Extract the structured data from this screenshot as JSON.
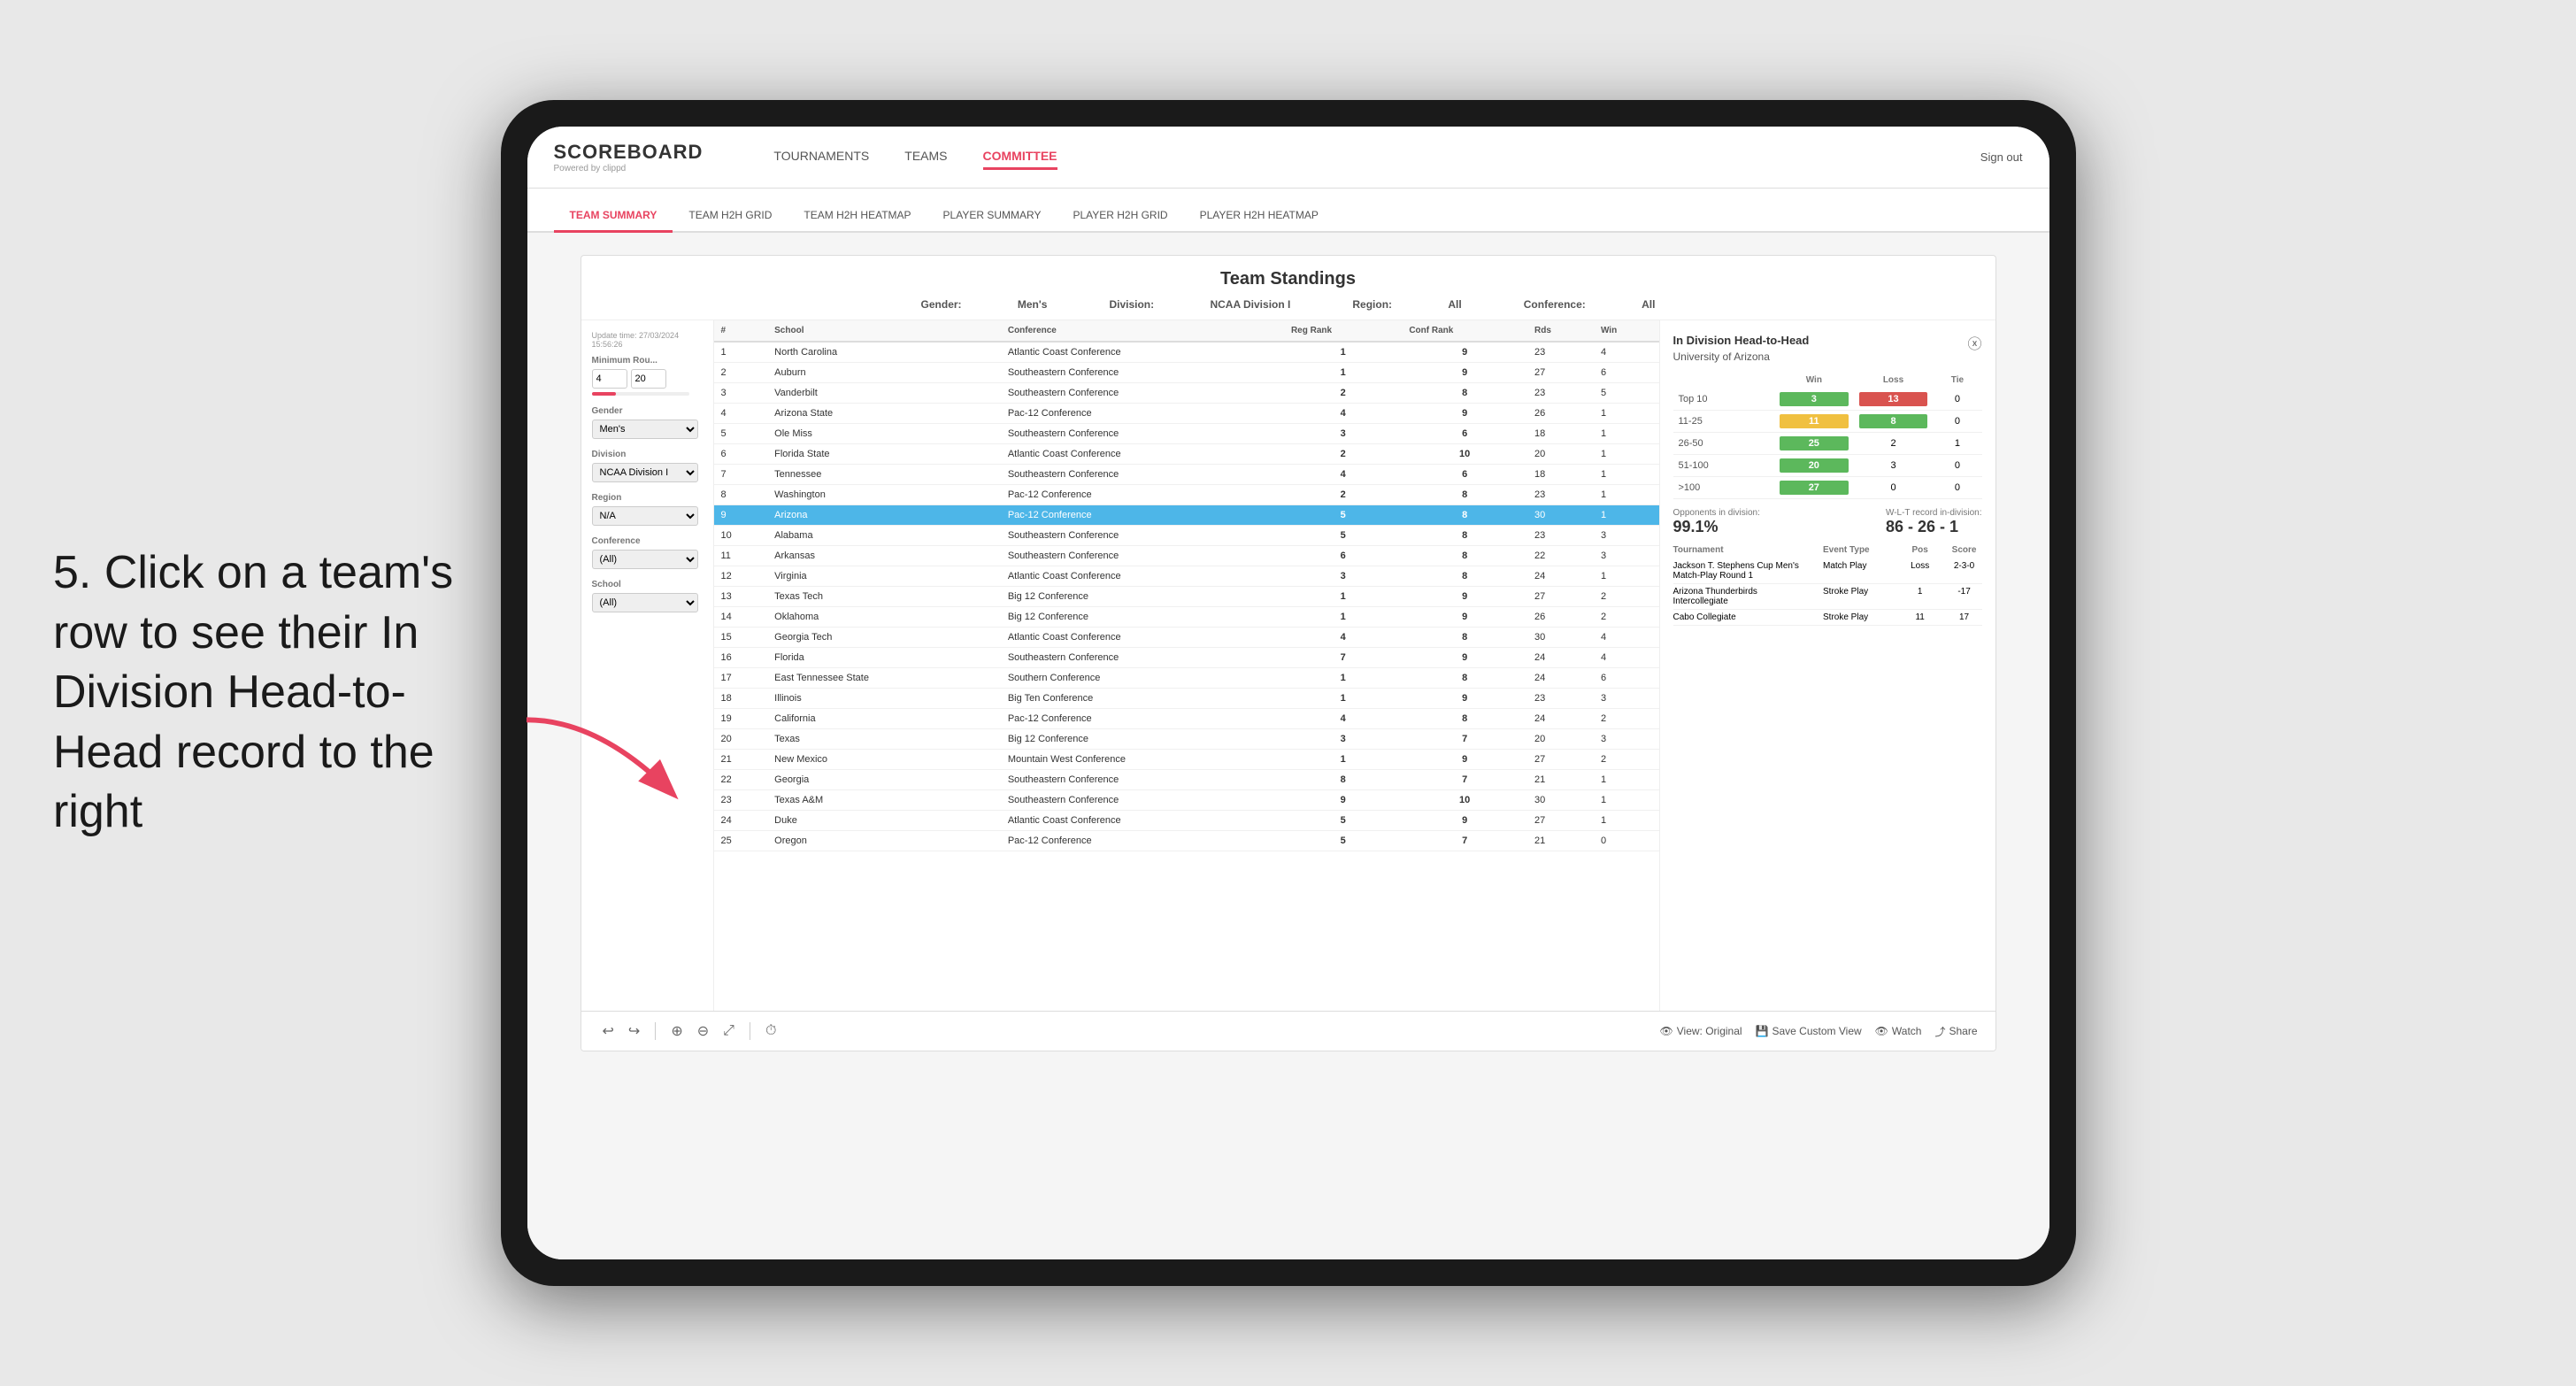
{
  "instruction": {
    "step": "5. Click on a team's row to see their In Division Head-to-Head record to the right"
  },
  "header": {
    "logo": "SCOREBOARD",
    "logo_sub": "Powered by clippd",
    "nav": [
      {
        "label": "TOURNAMENTS",
        "active": false
      },
      {
        "label": "TEAMS",
        "active": false
      },
      {
        "label": "COMMITTEE",
        "active": true
      }
    ],
    "sign_out": "Sign out"
  },
  "sub_nav": [
    {
      "label": "TEAM SUMMARY",
      "active": true
    },
    {
      "label": "TEAM H2H GRID",
      "active": false
    },
    {
      "label": "TEAM H2H HEATMAP",
      "active": false
    },
    {
      "label": "PLAYER SUMMARY",
      "active": false
    },
    {
      "label": "PLAYER H2H GRID",
      "active": false
    },
    {
      "label": "PLAYER H2H HEATMAP",
      "active": false
    }
  ],
  "panel": {
    "update_time": "Update time: 27/03/2024 15:56:26",
    "title": "Team Standings",
    "gender_label": "Gender:",
    "gender_value": "Men's",
    "division_label": "Division:",
    "division_value": "NCAA Division I",
    "region_label": "Region:",
    "region_value": "All",
    "conference_label": "Conference:",
    "conference_value": "All"
  },
  "filters": {
    "min_rounds_label": "Minimum Rou...",
    "min_rounds_value": "4",
    "min_rounds_max": "20",
    "gender_label": "Gender",
    "gender_value": "Men's",
    "division_label": "Division",
    "division_value": "NCAA Division I",
    "region_label": "Region",
    "region_value": "N/A",
    "conference_label": "Conference",
    "conference_value": "(All)",
    "school_label": "School",
    "school_value": "(All)"
  },
  "table": {
    "headers": [
      "#",
      "School",
      "Conference",
      "Reg Rank",
      "Conf Rank",
      "Rds",
      "Win"
    ],
    "rows": [
      {
        "rank": 1,
        "school": "North Carolina",
        "conference": "Atlantic Coast Conference",
        "reg_rank": 1,
        "conf_rank": 9,
        "rds": 23,
        "win": 4,
        "highlighted": false
      },
      {
        "rank": 2,
        "school": "Auburn",
        "conference": "Southeastern Conference",
        "reg_rank": 1,
        "conf_rank": 9,
        "rds": 27,
        "win": 6,
        "highlighted": false
      },
      {
        "rank": 3,
        "school": "Vanderbilt",
        "conference": "Southeastern Conference",
        "reg_rank": 2,
        "conf_rank": 8,
        "rds": 23,
        "win": 5,
        "highlighted": false
      },
      {
        "rank": 4,
        "school": "Arizona State",
        "conference": "Pac-12 Conference",
        "reg_rank": 4,
        "conf_rank": 9,
        "rds": 26,
        "win": 1,
        "highlighted": false
      },
      {
        "rank": 5,
        "school": "Ole Miss",
        "conference": "Southeastern Conference",
        "reg_rank": 3,
        "conf_rank": 6,
        "rds": 18,
        "win": 1,
        "highlighted": false
      },
      {
        "rank": 6,
        "school": "Florida State",
        "conference": "Atlantic Coast Conference",
        "reg_rank": 2,
        "conf_rank": 10,
        "rds": 20,
        "win": 1,
        "highlighted": false
      },
      {
        "rank": 7,
        "school": "Tennessee",
        "conference": "Southeastern Conference",
        "reg_rank": 4,
        "conf_rank": 6,
        "rds": 18,
        "win": 1,
        "highlighted": false
      },
      {
        "rank": 8,
        "school": "Washington",
        "conference": "Pac-12 Conference",
        "reg_rank": 2,
        "conf_rank": 8,
        "rds": 23,
        "win": 1,
        "highlighted": false
      },
      {
        "rank": 9,
        "school": "Arizona",
        "conference": "Pac-12 Conference",
        "reg_rank": 5,
        "conf_rank": 8,
        "rds": 30,
        "win": 1,
        "highlighted": true
      },
      {
        "rank": 10,
        "school": "Alabama",
        "conference": "Southeastern Conference",
        "reg_rank": 5,
        "conf_rank": 8,
        "rds": 23,
        "win": 3,
        "highlighted": false
      },
      {
        "rank": 11,
        "school": "Arkansas",
        "conference": "Southeastern Conference",
        "reg_rank": 6,
        "conf_rank": 8,
        "rds": 22,
        "win": 3,
        "highlighted": false
      },
      {
        "rank": 12,
        "school": "Virginia",
        "conference": "Atlantic Coast Conference",
        "reg_rank": 3,
        "conf_rank": 8,
        "rds": 24,
        "win": 1,
        "highlighted": false
      },
      {
        "rank": 13,
        "school": "Texas Tech",
        "conference": "Big 12 Conference",
        "reg_rank": 1,
        "conf_rank": 9,
        "rds": 27,
        "win": 2,
        "highlighted": false
      },
      {
        "rank": 14,
        "school": "Oklahoma",
        "conference": "Big 12 Conference",
        "reg_rank": 1,
        "conf_rank": 9,
        "rds": 26,
        "win": 2,
        "highlighted": false
      },
      {
        "rank": 15,
        "school": "Georgia Tech",
        "conference": "Atlantic Coast Conference",
        "reg_rank": 4,
        "conf_rank": 8,
        "rds": 30,
        "win": 4,
        "highlighted": false
      },
      {
        "rank": 16,
        "school": "Florida",
        "conference": "Southeastern Conference",
        "reg_rank": 7,
        "conf_rank": 9,
        "rds": 24,
        "win": 4,
        "highlighted": false
      },
      {
        "rank": 17,
        "school": "East Tennessee State",
        "conference": "Southern Conference",
        "reg_rank": 1,
        "conf_rank": 8,
        "rds": 24,
        "win": 6,
        "highlighted": false
      },
      {
        "rank": 18,
        "school": "Illinois",
        "conference": "Big Ten Conference",
        "reg_rank": 1,
        "conf_rank": 9,
        "rds": 23,
        "win": 3,
        "highlighted": false
      },
      {
        "rank": 19,
        "school": "California",
        "conference": "Pac-12 Conference",
        "reg_rank": 4,
        "conf_rank": 8,
        "rds": 24,
        "win": 2,
        "highlighted": false
      },
      {
        "rank": 20,
        "school": "Texas",
        "conference": "Big 12 Conference",
        "reg_rank": 3,
        "conf_rank": 7,
        "rds": 20,
        "win": 3,
        "highlighted": false
      },
      {
        "rank": 21,
        "school": "New Mexico",
        "conference": "Mountain West Conference",
        "reg_rank": 1,
        "conf_rank": 9,
        "rds": 27,
        "win": 2,
        "highlighted": false
      },
      {
        "rank": 22,
        "school": "Georgia",
        "conference": "Southeastern Conference",
        "reg_rank": 8,
        "conf_rank": 7,
        "rds": 21,
        "win": 1,
        "highlighted": false
      },
      {
        "rank": 23,
        "school": "Texas A&M",
        "conference": "Southeastern Conference",
        "reg_rank": 9,
        "conf_rank": 10,
        "rds": 30,
        "win": 1,
        "highlighted": false
      },
      {
        "rank": 24,
        "school": "Duke",
        "conference": "Atlantic Coast Conference",
        "reg_rank": 5,
        "conf_rank": 9,
        "rds": 27,
        "win": 1,
        "highlighted": false
      },
      {
        "rank": 25,
        "school": "Oregon",
        "conference": "Pac-12 Conference",
        "reg_rank": 5,
        "conf_rank": 7,
        "rds": 21,
        "win": 0,
        "highlighted": false
      }
    ]
  },
  "h2h": {
    "title": "In Division Head-to-Head",
    "school": "University of Arizona",
    "win_label": "Win",
    "loss_label": "Loss",
    "tie_label": "Tie",
    "rows": [
      {
        "range": "Top 10",
        "win": 3,
        "loss": 13,
        "tie": 0,
        "win_color": "green",
        "loss_color": "red"
      },
      {
        "range": "11-25",
        "win": 11,
        "loss": 8,
        "tie": 0,
        "win_color": "yellow",
        "loss_color": "green"
      },
      {
        "range": "26-50",
        "win": 25,
        "loss": 2,
        "tie": 1,
        "win_color": "green",
        "loss_color": "neutral"
      },
      {
        "range": "51-100",
        "win": 20,
        "loss": 3,
        "tie": 0,
        "win_color": "green",
        "loss_color": "neutral"
      },
      {
        "range": ">100",
        "win": 27,
        "loss": 0,
        "tie": 0,
        "win_color": "green",
        "loss_color": "neutral"
      }
    ],
    "opponents_label": "Opponents in division:",
    "opponents_value": "99.1%",
    "record_label": "W-L-T record in-division:",
    "record_value": "86 - 26 - 1",
    "tournaments": [
      {
        "name": "Jackson T. Stephens Cup Men's Match-Play Round",
        "event_type": "Match Play",
        "pos": "Loss",
        "score": "2-3-0",
        "sub": "1"
      },
      {
        "name": "Arizona Thunderbirds Intercollegiate",
        "event_type": "Stroke Play",
        "pos": "1",
        "score": "-17"
      },
      {
        "name": "Cabo Collegiate",
        "event_type": "Stroke Play",
        "pos": "11",
        "score": "17"
      }
    ]
  },
  "toolbar": {
    "view_original": "View: Original",
    "save_custom": "Save Custom View",
    "watch": "Watch",
    "share": "Share"
  }
}
